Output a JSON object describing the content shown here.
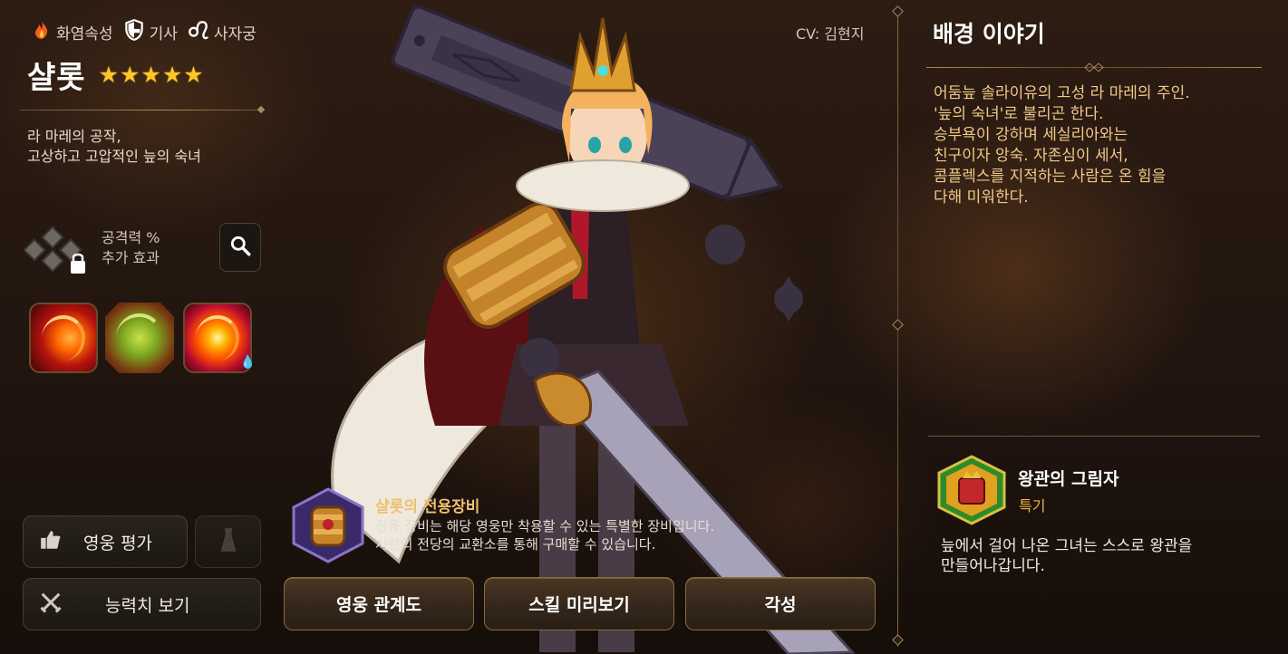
{
  "hero": {
    "attributes": [
      {
        "icon": "fire-icon",
        "label": "화염속성"
      },
      {
        "icon": "shield-icon",
        "label": "기사"
      },
      {
        "icon": "leo-icon",
        "label": "사자궁"
      }
    ],
    "name": "샬롯",
    "stars": 5,
    "description_lines": [
      "라 마레의 공작,",
      "고상하고 고압적인 늪의 숙녀"
    ],
    "cv": "CV: 김현지"
  },
  "rune": {
    "lines": [
      "공격력 %",
      "추가 효과"
    ]
  },
  "skills": [
    {
      "icon": "skill-slash-icon"
    },
    {
      "icon": "skill-claw-icon"
    },
    {
      "icon": "skill-vortex-icon"
    }
  ],
  "buttons": {
    "evaluation": "영웅 평가",
    "stats": "능력치 보기",
    "relations": "영웅 관계도",
    "skill_preview": "스킬 미리보기",
    "awaken": "각성"
  },
  "exclusive_equipment": {
    "title": "샬롯의 전용장비",
    "desc_lines": [
      "전용 장비는 해당 영웅만 착용할 수 있는 특별한 장비입니다.",
      "시련의 전당의 교환소를 통해 구매할 수 있습니다."
    ]
  },
  "story": {
    "title": "배경 이야기",
    "lines": [
      "어둠늪 솔라이유의 고성 라 마레의 주인.",
      "'늪의 숙녀'로 불리곤 한다.",
      "승부욕이 강하며 세실리아와는",
      "친구이자 앙숙. 자존심이 세서,",
      "콤플렉스를 지적하는 사람은 온 힘을",
      "다해 미워한다."
    ]
  },
  "specialty": {
    "name": "왕관의 그림자",
    "type": "특기",
    "desc_lines": [
      "늪에서 걸어 나온 그녀는 스스로 왕관을",
      "만들어나갑니다."
    ]
  },
  "colors": {
    "accent_gold": "#f0c070",
    "story_text": "#f0c88a",
    "star": "#ffc629"
  }
}
